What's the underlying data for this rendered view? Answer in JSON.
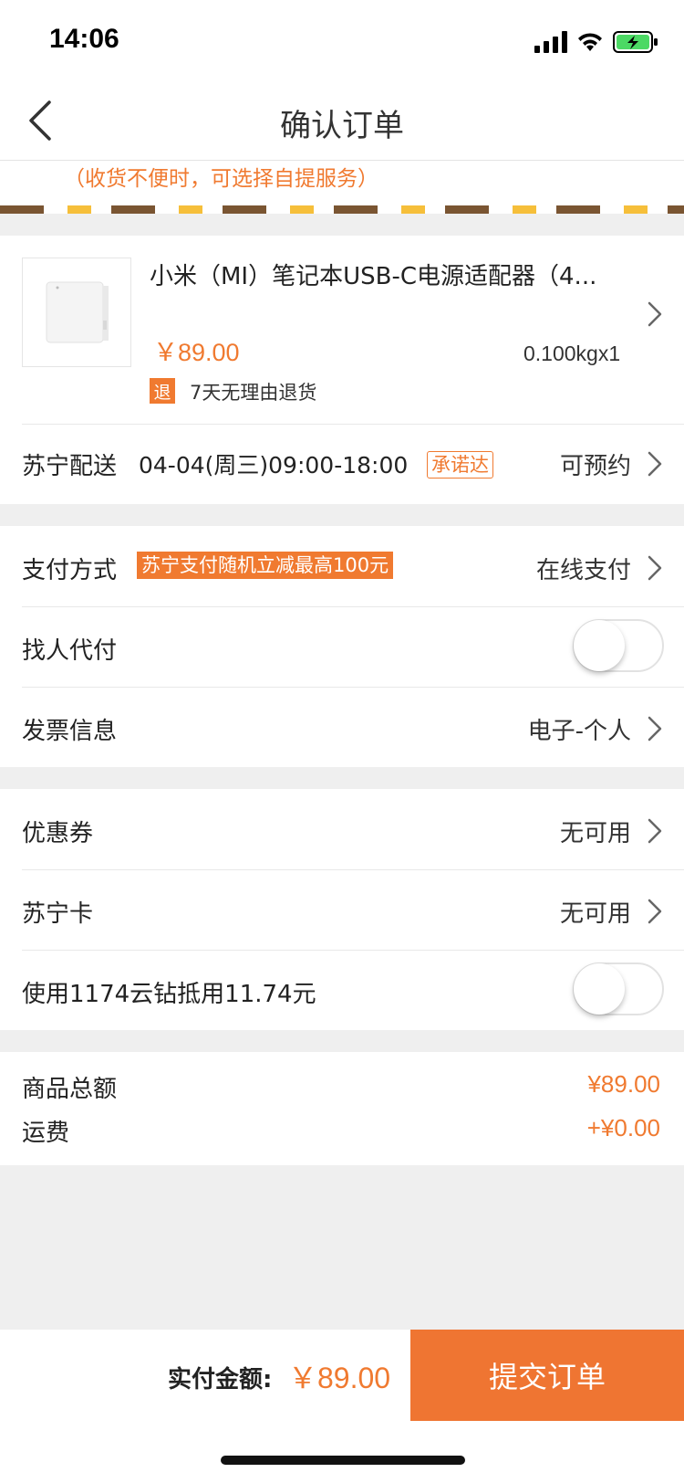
{
  "status_bar": {
    "time": "14:06"
  },
  "nav": {
    "title": "确认订单"
  },
  "address": {
    "note": "（收货不便时，可选择自提服务）"
  },
  "product": {
    "name": "小米（MI）笔记本USB-C电源适配器（4...",
    "price": "￥89.00",
    "weight": "0.100kgx1",
    "return_badge": "退",
    "return_text": "7天无理由退货"
  },
  "delivery": {
    "label": "苏宁配送",
    "time": "04-04(周三)09:00-18:00",
    "tag": "承诺达",
    "value": "可预约"
  },
  "payment": {
    "label": "支付方式",
    "promo": "苏宁支付随机立减最高100元",
    "value": "在线支付"
  },
  "proxy_pay": {
    "label": "找人代付",
    "enabled": false
  },
  "invoice": {
    "label": "发票信息",
    "value": "电子-个人"
  },
  "coupon": {
    "label": "优惠券",
    "value": "无可用"
  },
  "suning_card": {
    "label": "苏宁卡",
    "value": "无可用"
  },
  "diamonds": {
    "label": "使用1174云钻抵用11.74元",
    "enabled": false
  },
  "summary": {
    "goods_label": "商品总额",
    "goods_value": "¥89.00",
    "shipping_label": "运费",
    "shipping_value": "+¥0.00"
  },
  "bottom": {
    "pay_label": "实付金额:",
    "pay_amount": "￥89.00",
    "submit_label": "提交订单"
  },
  "colors": {
    "accent": "#f07a30",
    "background": "#efefef"
  }
}
